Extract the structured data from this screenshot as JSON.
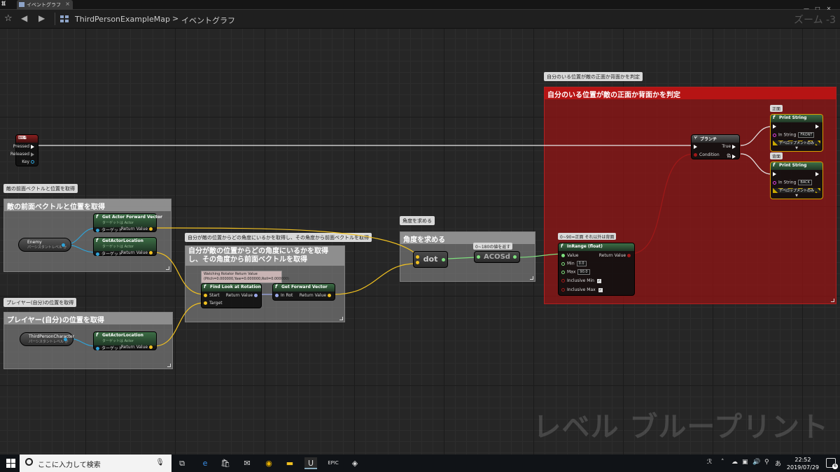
{
  "window": {
    "tab_label": "イベントグラフ",
    "close": "×",
    "minimize": "—",
    "maximize": "□",
    "close_window": "✕"
  },
  "breadcrumb": {
    "map": "ThirdPersonExampleMap",
    "separator": ">",
    "graph": "イベントグラフ",
    "zoom": "ズーム -3"
  },
  "watermark": "レベル ブループリント",
  "comments": {
    "enemy_vec": {
      "bubble": "敵の前面ベクトルと位置を取得",
      "title": "敵の前面ベクトルと位置を取得"
    },
    "player": {
      "bubble": "プレイヤー(自分)の位置を取得",
      "title": "プレイヤー(自分)の位置を取得"
    },
    "lookat": {
      "bubble": "自分が敵の位置からどの角度にいるかを取得し、その角度から前面ベクトルを取得",
      "title": "自分が敵の位置からどの角度にいるかを取得し、その角度から前面ベクトルを取得"
    },
    "angle": {
      "bubble": "角度を求める",
      "title": "角度を求める"
    },
    "judge": {
      "bubble": "自分のいる位置が敵の正面か背面かを判定",
      "title": "自分のいる位置が敵の正面か背面かを判定"
    }
  },
  "nodes": {
    "g_key": {
      "title": "G",
      "pressed": "Pressed",
      "released": "Released",
      "key": "Key"
    },
    "enemy_var": {
      "title": "Enemy",
      "sub": "パーシスタントレベル か"
    },
    "third_var": {
      "title": "ThirdPersonCharacter",
      "sub": "パーシスタントレベル か"
    },
    "get_forward": {
      "title": "Get Actor Forward Vector",
      "sub": "ターゲットは Actor",
      "target": "ターゲット",
      "ret": "Return Value"
    },
    "get_loc1": {
      "title": "GetActorLocation",
      "sub": "ターゲットは Actor",
      "target": "ターゲット",
      "ret": "Return Value"
    },
    "get_loc2": {
      "title": "GetActorLocation",
      "sub": "ターゲットは Actor",
      "target": "ターゲット",
      "ret": "Return Value"
    },
    "watch": {
      "line1": "Watching Rotator Return Value",
      "line2": "(Pitch=0.000000,Yaw=0.000000,Roll=0.000000)"
    },
    "find_look": {
      "title": "Find Look at Rotation",
      "start": "Start",
      "target": "Target",
      "ret": "Return Value"
    },
    "get_fwd_vec": {
      "title": "Get Forward Vector",
      "in_rot": "In Rot",
      "ret": "Return Value"
    },
    "dot": {
      "title": "dot"
    },
    "acos_bubble": "0~180の値を返す",
    "acos": {
      "title": "ACOSd"
    },
    "inrange_bubble": "0~90=正面 それ以外は背面",
    "inrange": {
      "title": "InRange (float)",
      "value": "Value",
      "min": "Min",
      "min_val": "0.0",
      "max": "Max",
      "max_val": "90.0",
      "inc_min": "Inclusive Min",
      "inc_max": "Inclusive Max",
      "ret": "Return Value"
    },
    "branch": {
      "title": "ブランチ",
      "condition": "Condition",
      "true": "True",
      "false": "偽"
    },
    "front_bubble": "正面",
    "back_bubble": "背面",
    "print_front": {
      "title": "Print String",
      "in_string": "In String",
      "value": "FRONT",
      "dev": "デベロップメントのみ"
    },
    "print_back": {
      "title": "Print String",
      "in_string": "In String",
      "value": "BACK",
      "dev": "デベロップメントのみ"
    }
  },
  "taskbar": {
    "search_placeholder": "ここに入力して検索",
    "time": "22:52",
    "date": "2019/07/29",
    "notif_count": "6"
  },
  "icons": [
    "unreal-logo-icon",
    "star-icon",
    "back-arrow-icon",
    "forward-arrow-icon",
    "blueprint-icon",
    "windows-start-icon",
    "search-icon",
    "mic-icon",
    "task-view-icon",
    "edge-icon",
    "store-icon",
    "mail-icon",
    "chrome-icon",
    "explorer-icon",
    "unreal-icon",
    "epic-icon",
    "app-icon"
  ]
}
